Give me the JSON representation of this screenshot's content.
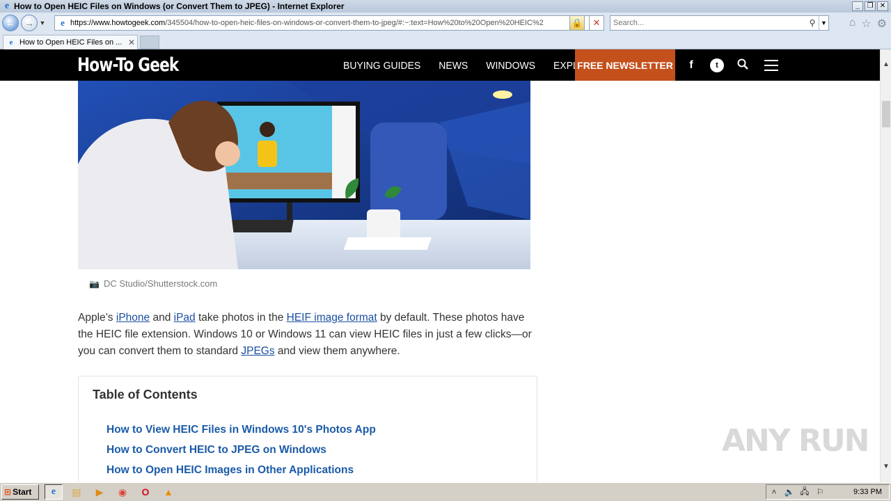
{
  "window": {
    "title": "How to Open HEIC Files on Windows (or Convert Them to JPEG) - Internet Explorer",
    "controls": {
      "minimize": "_",
      "restore": "❐",
      "close": "✕"
    }
  },
  "address": {
    "url_host": "https://www.howtogeek.com",
    "url_rest": "/345504/how-to-open-heic-files-on-windows-or-convert-them-to-jpeg/#:~:text=How%20to%20Open%20HEIC%2"
  },
  "search": {
    "placeholder": "Search..."
  },
  "tab": {
    "label": "How to Open HEIC Files on ..."
  },
  "site": {
    "logo": "How-To Geek",
    "nav": [
      "BUYING GUIDES",
      "NEWS",
      "WINDOWS",
      "EXPLORE"
    ],
    "newsletter": "FREE NEWSLETTER",
    "brand_color": "#c4501c"
  },
  "article": {
    "caption": "DC Studio/Shutterstock.com",
    "para": {
      "t1": "Apple’s ",
      "link1": "iPhone",
      "t2": " and ",
      "link2": "iPad",
      "t3": " take photos in the ",
      "link3": "HEIF image format",
      "t4": " by default. These photos have the HEIC file extension. Windows 10 or Windows 11 can view HEIC files in just a few clicks—or you can convert them to standard ",
      "link4": "JPEGs",
      "t5": " and view them anywhere."
    },
    "toc": {
      "title": "Table of Contents",
      "items": [
        "How to View HEIC Files in Windows 10's Photos App",
        "How to Convert HEIC to JPEG on Windows",
        "How to Open HEIC Images in Other Applications"
      ]
    }
  },
  "watermark": "ANY RUN",
  "taskbar": {
    "start": "Start",
    "clock": "9:33 PM"
  }
}
